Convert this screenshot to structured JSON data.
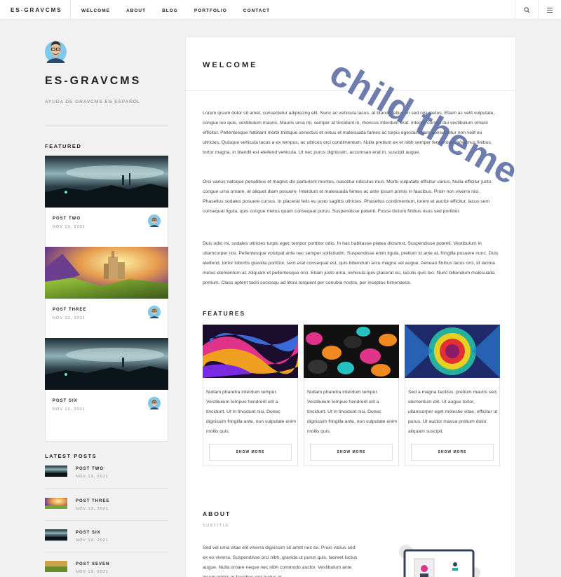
{
  "nav": {
    "brand": "ES-GRAVCMS",
    "items": [
      "WELCOME",
      "ABOUT",
      "BLOG",
      "PORTFOLIO",
      "CONTACT"
    ],
    "icons": [
      "search-icon",
      "menu-icon"
    ]
  },
  "sidebar": {
    "title": "ES-GRAVCMS",
    "subtitle": "AYUDA DE GRAVCMS EN ESPAÑOL",
    "featured_heading": "FEATURED",
    "featured": [
      {
        "title": "POST TWO",
        "date": "NOV 13, 2021"
      },
      {
        "title": "POST THREE",
        "date": "NOV 13, 2021"
      },
      {
        "title": "POST SIX",
        "date": "NOV 13, 2021"
      }
    ],
    "latest_heading": "LATEST POSTS",
    "latest": [
      {
        "title": "POST TWO",
        "date": "NOV 13, 2021"
      },
      {
        "title": "POST THREE",
        "date": "NOV 13, 2021"
      },
      {
        "title": "POST SIX",
        "date": "NOV 13, 2021"
      },
      {
        "title": "POST SEVEN",
        "date": "NOV 13, 2021"
      }
    ]
  },
  "main": {
    "title": "WELCOME",
    "paragraphs": [
      "Lorem ipsum dolor sit amet, consectetur adipiscing elit. Nunc ac vehicula lacus, at blandit tellus. In sed nisi metus. Etiam ac velit vulputate, congue leo quis, vestibulum mauris. Mauris urna mi, semper at tincidunt in, rhoncus interdum erat. Integer cursus dui vestibulum ornare efficitur. Pellentesque habitant morbi tristique senectus et netus et malesuada fames ac turpis egestas. Nam consectetur non velit eu ultricies. Quisque vehicula lacus a ex tempus, ac ultrices orci condimentum. Nulla pretium ex et nibh semper fermentum. Vivamus finibus tortor magna, in blandit est eleifend vehicula. Ut nec purus dignissim, accumsan erat in, suscipit augue.",
      "Orci varius natoque penatibus et magnis dis parturient montes, nascetur ridiculus mus. Morbi vulputate efficitur varius. Nulla efficitur justo congue urna ornare, at aliquet diam posuere. Interdum et malesuada fames ac ante ipsum primis in faucibus. Proin non viverra nisi. Phasellus sodales posuere cursus. In placerat felis eu justo sagittis ultricies. Phasellus condimentum, lorem et auctor efficitur, lacus sem consequat ligula, quis congue metus quam consequat purus. Suspendisse potenti. Fusce dictum finibus risus sed porttitor.",
      "Duis odio mi, sodales ultricies turpis eget, tempor porttitor odio. In hac habitasse platea dictumst. Suspendisse potenti. Vestibulum in ullamcorper nisi. Pellentesque volutpat ante nec semper sollicitudin. Suspendisse enim ligula, pretium id ante at, fringilla posuere nunc. Duis eleifend, tortor lobortis gravida porttitor, sem erat consequat est, quis bibendum arcu magna vel augue. Aenean finibus lacus orci, id lacinia metus elementum at. Aliquam et pellentesque orci. Etiam justo urna, vehicula quis placerat eu, iaculis quis leo. Nunc bibendum malesuada pretium. Class aptent taciti sociosqu ad litora torquent per conubia nostra, per inceptos himenaeos."
    ],
    "features_heading": "FEATURES",
    "features": [
      {
        "text": "Nullam pharetra interdum tempor. Vestibulum tempus hendrerit elit a tincidunt. Ut in tincidunt nisi. Donec dignissim fringilla ante, non vulputate enim mollis quis.",
        "button": "SHOW MORE"
      },
      {
        "text": "Nullam pharetra interdum tempor. Vestibulum tempus hendrerit elit a tincidunt. Ut in tincidunt nisi. Donec dignissim fringilla ante, non vulputate enim mollis quis.",
        "button": "SHOW MORE"
      },
      {
        "text": "Sed a magna facilisis, pretium mauris sed, elementum elit. Ut augue tortor, ullamcorper eget molestie vitae, efficitur ut purus. Ut auctor massa pretium dolor aliquam suscipit.",
        "button": "SHOW MORE"
      }
    ],
    "about_heading": "ABOUT",
    "about_subtitle": "SUBTITLE",
    "about_text": "Sed vel urna vitae elit viverra dignissim sit amet nec ex. Proin varius sed ex eu viverra. Suspendisse orci nibh, gravida ut purus quis, laoreet luctus augue. Nulla ornare neque nec nibh commodo auctor. Vestibulum ante ipsum primis in faucibus orci luctus et"
  },
  "watermark": "child theme"
}
